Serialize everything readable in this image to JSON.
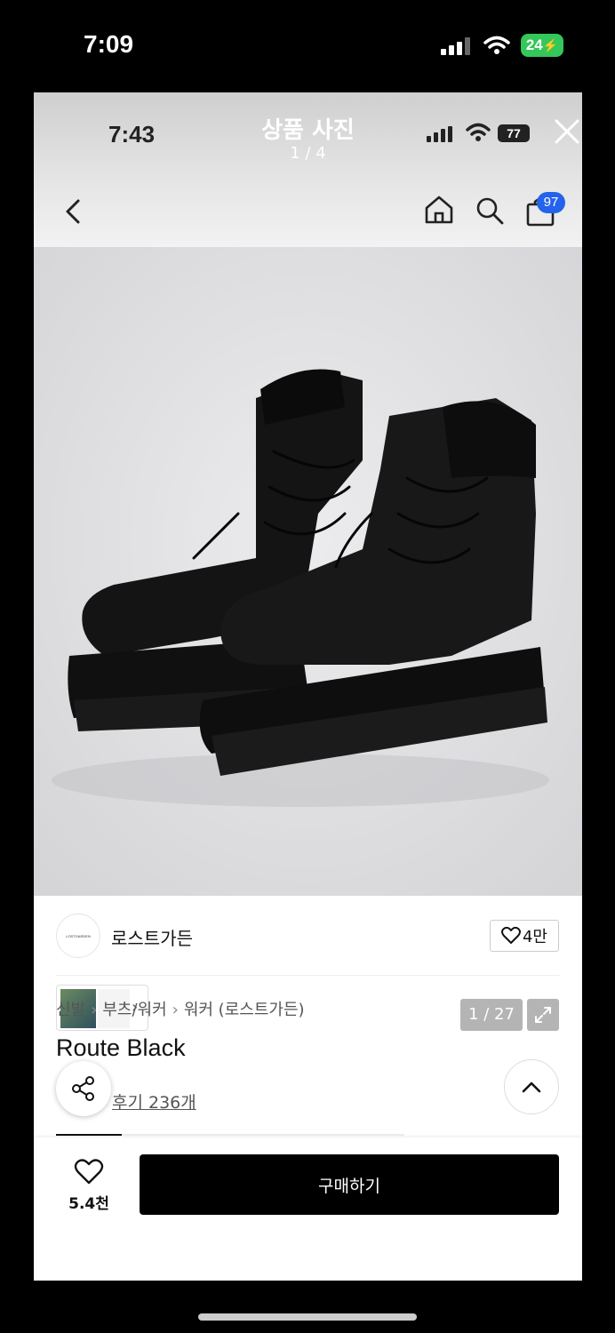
{
  "outer_status": {
    "time": "7:09",
    "battery": "24"
  },
  "inner_status": {
    "time": "7:43",
    "battery": "77"
  },
  "viewer": {
    "title": "상품 사진",
    "count": "1 / 4"
  },
  "nav": {
    "cart_badge": "97"
  },
  "gallery": {
    "counter": "1 / 27"
  },
  "brand": {
    "logo_text": "LOSTGARDEN",
    "name": "로스트가든",
    "likes": "4만"
  },
  "breadcrumb": [
    "신발",
    "부츠/워커",
    "워커 (로스트가든)"
  ],
  "product": {
    "name": "Route Black",
    "reviews": "후기 236개"
  },
  "bottom": {
    "wish_count": "5.4천",
    "buy_label": "구매하기"
  },
  "colors": {
    "accent": "#2463eb",
    "battery_green": "#34c759",
    "buy_bg": "#000000"
  }
}
